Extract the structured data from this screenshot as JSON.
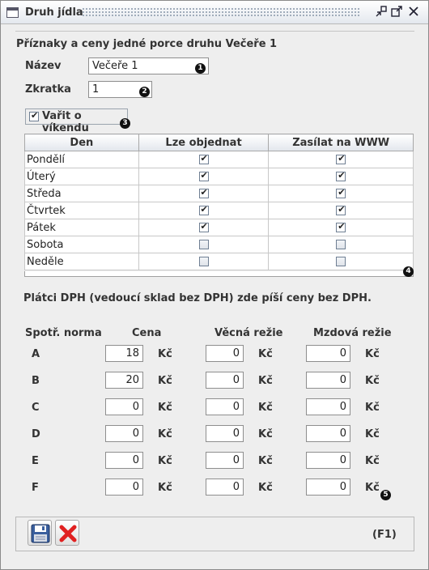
{
  "window": {
    "title": "Druh jídla",
    "controls": [
      "minimize-icon",
      "maximize-icon",
      "close-icon"
    ]
  },
  "heading": "Příznaky a ceny jedné porce druhu Večeře 1",
  "fields": {
    "nazev_label": "Název",
    "nazev_value": "Večeře 1",
    "zkratka_label": "Zkratka",
    "zkratka_value": "1"
  },
  "weekend": {
    "label": "Vařit o víkendu",
    "checked": true
  },
  "badges": [
    "1",
    "2",
    "3",
    "4",
    "5"
  ],
  "days_table": {
    "headers": [
      "Den",
      "Lze objednat",
      "Zasílat na WWW"
    ],
    "rows": [
      {
        "day": "Pondělí",
        "lze_objednat": true,
        "www": true
      },
      {
        "day": "Úterý",
        "lze_objednat": true,
        "www": true
      },
      {
        "day": "Středa",
        "lze_objednat": true,
        "www": true
      },
      {
        "day": "Čtvrtek",
        "lze_objednat": true,
        "www": true
      },
      {
        "day": "Pátek",
        "lze_objednat": true,
        "www": true
      },
      {
        "day": "Sobota",
        "lze_objednat": false,
        "www": false
      },
      {
        "day": "Neděle",
        "lze_objednat": false,
        "www": false
      }
    ]
  },
  "vat_note": "Plátci DPH (vedoucí sklad bez DPH) zde píší ceny bez DPH.",
  "price_table": {
    "headers": {
      "norma": "Spotř. norma",
      "cena": "Cena",
      "vecna": "Věcná režie",
      "mzdova": "Mzdová režie"
    },
    "currency": "Kč",
    "rows": [
      {
        "norma": "A",
        "cena": "18",
        "vecna": "0",
        "mzdova": "0"
      },
      {
        "norma": "B",
        "cena": "20",
        "vecna": "0",
        "mzdova": "0"
      },
      {
        "norma": "C",
        "cena": "0",
        "vecna": "0",
        "mzdova": "0"
      },
      {
        "norma": "D",
        "cena": "0",
        "vecna": "0",
        "mzdova": "0"
      },
      {
        "norma": "E",
        "cena": "0",
        "vecna": "0",
        "mzdova": "0"
      },
      {
        "norma": "F",
        "cena": "0",
        "vecna": "0",
        "mzdova": "0"
      }
    ]
  },
  "footer": {
    "save_icon": "save-icon",
    "cancel_icon": "cancel-icon",
    "shortcut": "(F1)"
  },
  "colors": {
    "cancel_red": "#e02020",
    "save_blue": "#3a5f9e"
  }
}
